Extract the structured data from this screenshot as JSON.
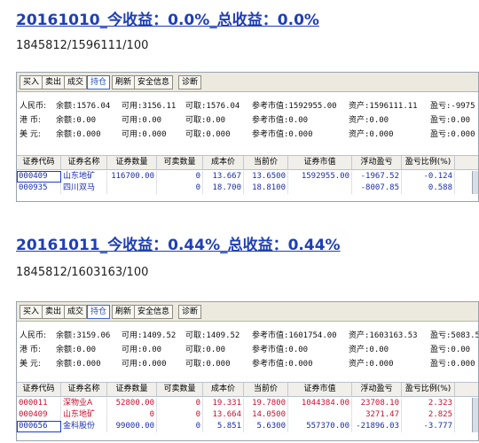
{
  "posts": [
    {
      "title": "20161010_今收益：0.0%_总收益：0.0%",
      "subtitle": "1845812/1596111/100",
      "toolbar": [
        "买入",
        "卖出",
        "成交",
        "持仓",
        "刷新",
        "安全信息",
        "诊断"
      ],
      "active_tab": 3,
      "accounts": [
        {
          "name": "人民币:",
          "balance": "余额:1576.04",
          "available": "可用:3156.11",
          "withdrawable": "可取:1576.04",
          "ref_value": "参考市值:1592955.00",
          "assets": "资产:1596111.11",
          "pnl": "盈亏:-9975"
        },
        {
          "name": "港  币:",
          "balance": "余额:0.00",
          "available": "可用:0.00",
          "withdrawable": "可取:0.00",
          "ref_value": "参考市值:0.00",
          "assets": "资产:0.00",
          "pnl": "盈亏:0.00"
        },
        {
          "name": "美  元:",
          "balance": "余额:0.000",
          "available": "可用:0.000",
          "withdrawable": "可取:0.000",
          "ref_value": "参考市值:0.000",
          "assets": "资产:0.000",
          "pnl": "盈亏:0.000"
        }
      ],
      "columns": [
        "证券代码",
        "证券名称",
        "证券数量",
        "可卖数量",
        "成本价",
        "当前价",
        "证券市值",
        "浮动盈亏",
        "盈亏比例(%)"
      ],
      "rows": [
        {
          "code": "000409",
          "name": "山东地矿",
          "qty": "116700.00",
          "sellable": "0",
          "cost": "13.667",
          "price": "13.6500",
          "value": "1592955.00",
          "float_pnl": "-1967.52",
          "ratio": "-0.124",
          "color": "blue",
          "selected": true
        },
        {
          "code": "000935",
          "name": "四川双马",
          "qty": "",
          "sellable": "0",
          "cost": "18.700",
          "price": "18.8100",
          "value": "",
          "float_pnl": "-8007.85",
          "ratio": "0.588",
          "color": "blue",
          "selected": false
        }
      ]
    },
    {
      "title": "20161011_今收益：0.44%_总收益：0.44%",
      "subtitle": "1845812/1603163/100",
      "toolbar": [
        "买入",
        "卖出",
        "成交",
        "持仓",
        "刷新",
        "安全信息",
        "诊断"
      ],
      "active_tab": 3,
      "accounts": [
        {
          "name": "人民币:",
          "balance": "余额:3159.06",
          "available": "可用:1409.52",
          "withdrawable": "可取:1409.52",
          "ref_value": "参考市值:1601754.00",
          "assets": "资产:1603163.53",
          "pnl": "盈亏:5083.5"
        },
        {
          "name": "港  币:",
          "balance": "余额:0.00",
          "available": "可用:0.00",
          "withdrawable": "可取:0.00",
          "ref_value": "参考市值:0.00",
          "assets": "资产:0.00",
          "pnl": "盈亏:0.00"
        },
        {
          "name": "美  元:",
          "balance": "余额:0.000",
          "available": "可用:0.000",
          "withdrawable": "可取:0.000",
          "ref_value": "参考市值:0.000",
          "assets": "资产:0.000",
          "pnl": "盈亏:0.000"
        }
      ],
      "columns": [
        "证券代码",
        "证券名称",
        "证券数量",
        "可卖数量",
        "成本价",
        "当前价",
        "证券市值",
        "浮动盈亏",
        "盈亏比例(%)"
      ],
      "rows": [
        {
          "code": "000011",
          "name": "深物业A",
          "qty": "52800.00",
          "sellable": "0",
          "cost": "19.331",
          "price": "19.7800",
          "value": "1044384.00",
          "float_pnl": "23708.10",
          "ratio": "2.323",
          "color": "red",
          "selected": false
        },
        {
          "code": "000409",
          "name": "山东地矿",
          "qty": "0",
          "sellable": "0",
          "cost": "13.664",
          "price": "14.0500",
          "value": "",
          "float_pnl": "3271.47",
          "ratio": "2.825",
          "color": "red",
          "selected": false
        },
        {
          "code": "000656",
          "name": "金科股份",
          "qty": "99000.00",
          "sellable": "0",
          "cost": "5.851",
          "price": "5.6300",
          "value": "557370.00",
          "float_pnl": "-21896.03",
          "ratio": "-3.777",
          "color": "blue",
          "selected": true
        }
      ]
    }
  ],
  "colors": {
    "title": "#1f3fb4",
    "gain": "#c8102e",
    "loss": "#1a2ea8",
    "toolbar_bg": "#ece9de"
  }
}
